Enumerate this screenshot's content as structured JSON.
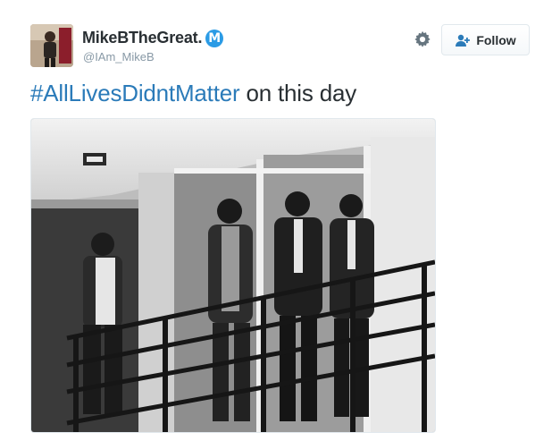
{
  "user": {
    "display_name": "MikeBTheGreat.",
    "verified_badge": "M",
    "handle": "@IAm_MikeB"
  },
  "actions": {
    "follow_label": "Follow",
    "settings_icon": "gear-icon",
    "follow_icon": "add-user-icon"
  },
  "tweet": {
    "hashtag": "#AllLivesDidntMatter",
    "text": " on this day"
  },
  "colors": {
    "link": "#2b7bb9",
    "verified": "#2b9be5",
    "muted": "#8899a6"
  }
}
